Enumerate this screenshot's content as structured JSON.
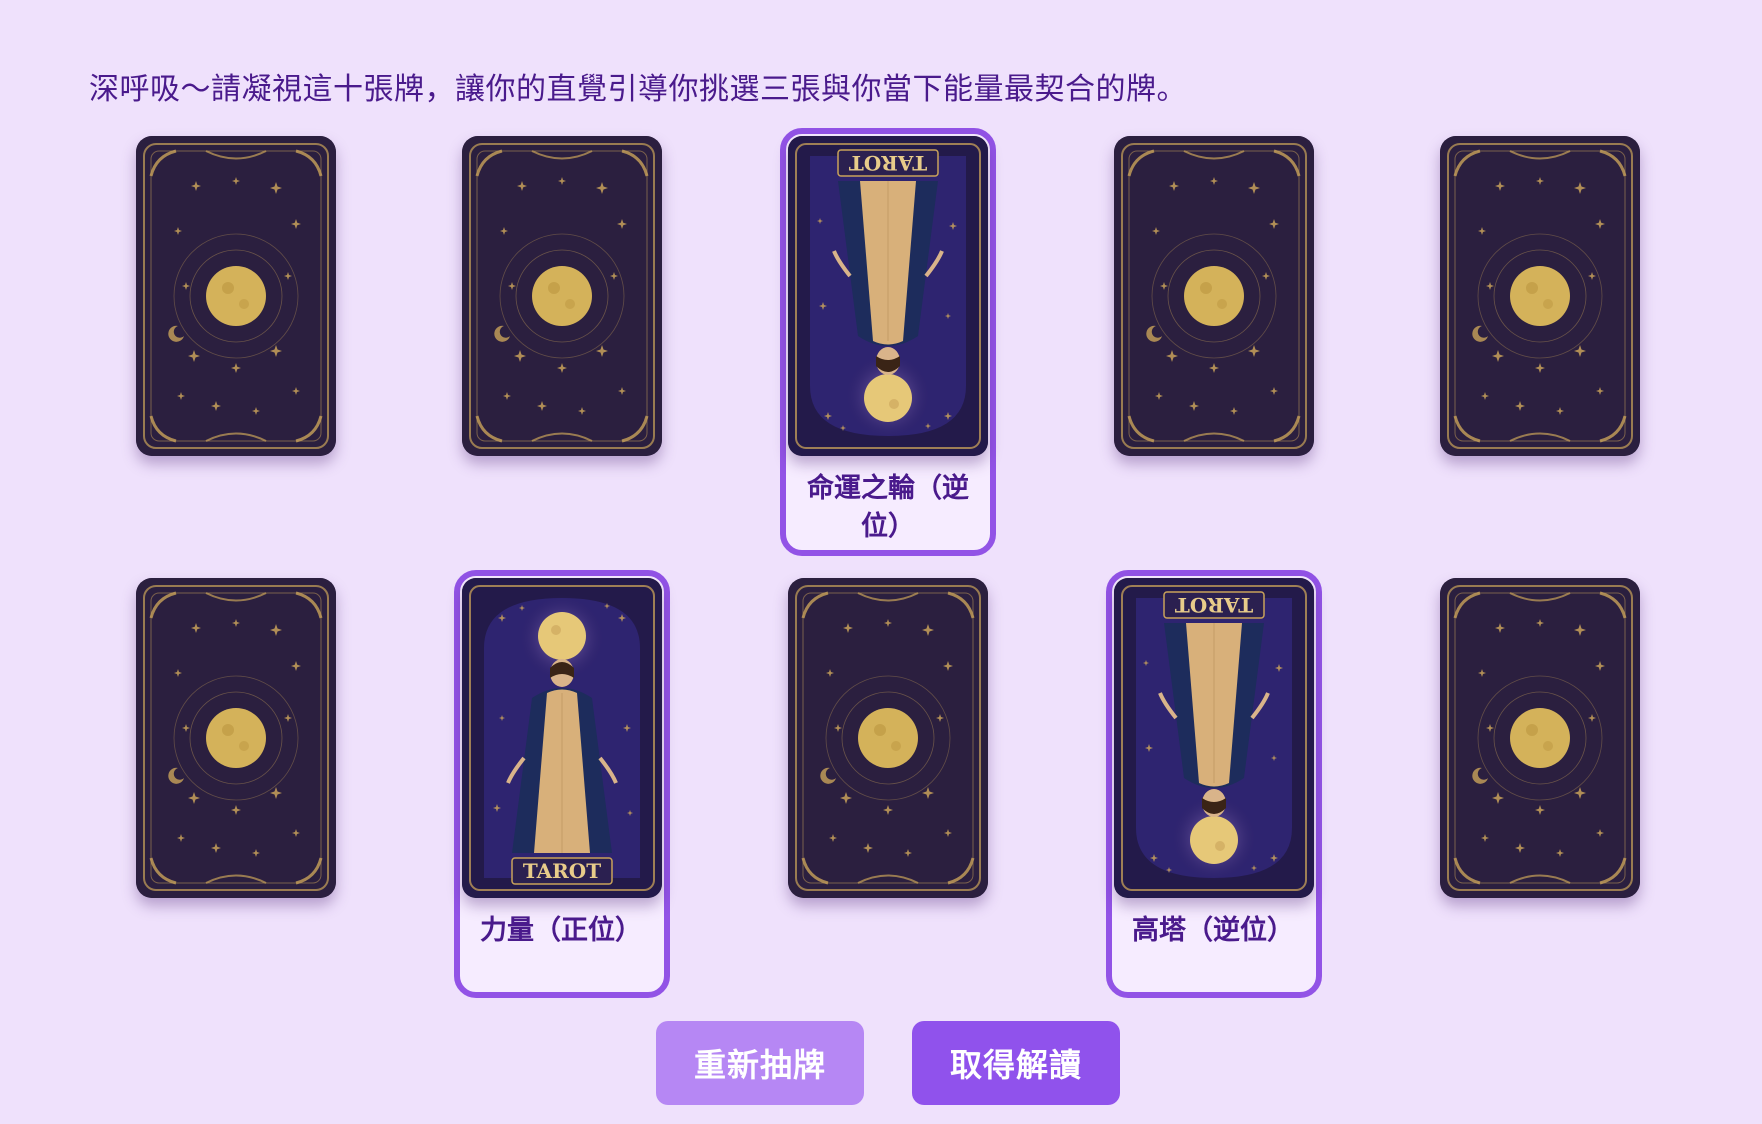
{
  "instruction": "深呼吸～請凝視這十張牌，讓你的直覺引導你挑選三張與你當下能量最契合的牌。",
  "cards": [
    {
      "state": "back"
    },
    {
      "state": "back"
    },
    {
      "state": "selected",
      "orientation": "reversed",
      "label": "命運之輪（逆位）",
      "banner": "TAROT"
    },
    {
      "state": "back"
    },
    {
      "state": "back"
    },
    {
      "state": "back"
    },
    {
      "state": "selected",
      "orientation": "upright",
      "label": "力量（正位）",
      "banner": "TAROT"
    },
    {
      "state": "back"
    },
    {
      "state": "selected",
      "orientation": "reversed",
      "label": "高塔（逆位）",
      "banner": "TAROT"
    },
    {
      "state": "back"
    }
  ],
  "buttons": {
    "redraw": "重新抽牌",
    "read": "取得解讀"
  },
  "colors": {
    "background": "#efe1fc",
    "accent": "#9253e6",
    "text": "#4a1a8c",
    "card_back": "#2a1e3c",
    "gold": "#c9a25a"
  }
}
